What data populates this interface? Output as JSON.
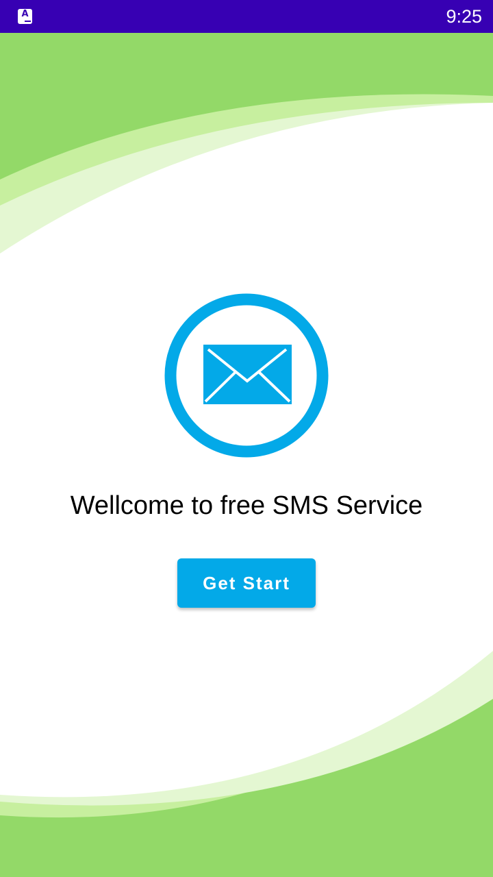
{
  "status_bar": {
    "app_icon": "app-notification-icon",
    "app_icon_letter": "A",
    "time": "9:25"
  },
  "main": {
    "logo_icon": "envelope-icon",
    "welcome_text": "Wellcome to free SMS Service",
    "start_button_label": "Get Start"
  },
  "colors": {
    "status_bar": "#3700b3",
    "accent": "#03a9e8",
    "green_band": "#93d968",
    "light_green": "#c7ef9f",
    "background": "#ffffff"
  }
}
